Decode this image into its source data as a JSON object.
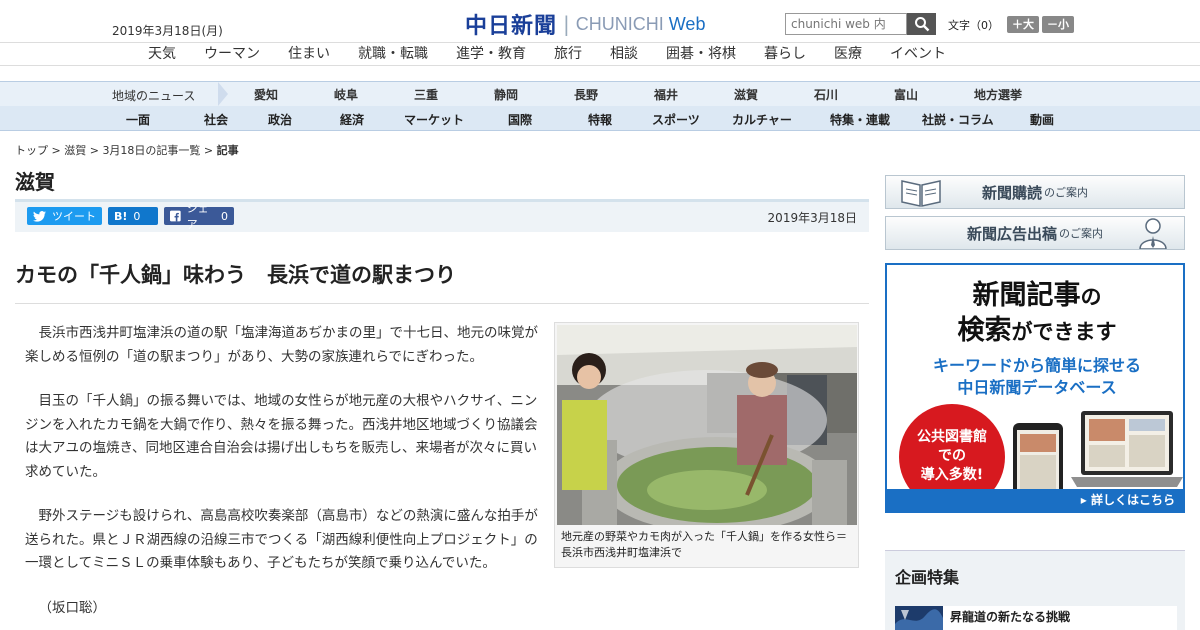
{
  "header": {
    "date": "2019年3月18日(月)",
    "logo_jp": "中日新聞",
    "logo_en": "CHUNICHI",
    "logo_web": "Web",
    "search_placeholder": "chunichi web 内",
    "fontsize_label": "文字（0）",
    "fontsize_plus": "＋大",
    "fontsize_minus": "－小"
  },
  "top_nav": [
    "天気",
    "ウーマン",
    "住まい",
    "就職・転職",
    "進学・教育",
    "旅行",
    "相談",
    "囲碁・将棋",
    "暮らし",
    "医療",
    "イベント"
  ],
  "region_nav": {
    "label": "地域のニュース",
    "items": [
      "愛知",
      "岐阜",
      "三重",
      "静岡",
      "長野",
      "福井",
      "滋賀",
      "石川",
      "富山",
      "地方選挙"
    ]
  },
  "category_nav": [
    "一面",
    "社会",
    "政治",
    "経済",
    "マーケット",
    "国際",
    "特報",
    "スポーツ",
    "カルチャー",
    "特集・連載",
    "社説・コラム",
    "動画"
  ],
  "breadcrumb": {
    "items": [
      "トップ",
      "滋賀",
      "3月18日の記事一覧"
    ],
    "current": "記事",
    "sep": " > "
  },
  "section_title": "滋賀",
  "share": {
    "tweet": "ツイート",
    "hatena_icon": "B!",
    "hatena_count": "0",
    "facebook": "シェア",
    "facebook_count": "0"
  },
  "article": {
    "date": "2019年3月18日",
    "headline": "カモの「千人鍋」味わう　長浜で道の駅まつり",
    "paragraphs": [
      "長浜市西浅井町塩津浜の道の駅「塩津海道あぢかまの里」で十七日、地元の味覚が楽しめる恒例の「道の駅まつり」があり、大勢の家族連れらでにぎわった。",
      "目玉の「千人鍋」の振る舞いでは、地域の女性らが地元産の大根やハクサイ、ニンジンを入れたカモ鍋を大鍋で作り、熱々を振る舞った。西浅井地区地域づくり協議会は大アユの塩焼き、同地区連合自治会は揚げ出しもちを販売し、来場者が次々に買い求めていた。",
      "野外ステージも設けられ、高島高校吹奏楽部（高島市）などの熱演に盛んな拍手が送られた。県とＪＲ湖西線の沿線三市でつくる「湖西線利便性向上プロジェクト」の一環としてミニＳＬの乗車体験もあり、子どもたちが笑顔で乗り込んでいた。",
      "（坂口聡）"
    ],
    "photo_caption": "地元産の野菜やカモ肉が入った「千人鍋」を作る女性ら＝長浜市西浅井町塩津浜で"
  },
  "sidebar": {
    "banner1_main": "新聞購読",
    "banner1_sub": "のご案内",
    "banner2_main": "新聞広告出稿",
    "banner2_sub": "のご案内",
    "ad": {
      "line1a": "新聞記事",
      "line1b": "の",
      "line2a": "検索",
      "line2b": "ができます",
      "sub1": "キーワードから簡単に探せる",
      "sub2": "中日新聞データベース",
      "circle1": "公共図書館",
      "circle2": "での",
      "circle3": "導入多数!",
      "cta": "▸ 詳しくはこちら"
    },
    "kikaku_title": "企画特集",
    "kikaku_item": "昇龍道の新たなる挑戦"
  }
}
